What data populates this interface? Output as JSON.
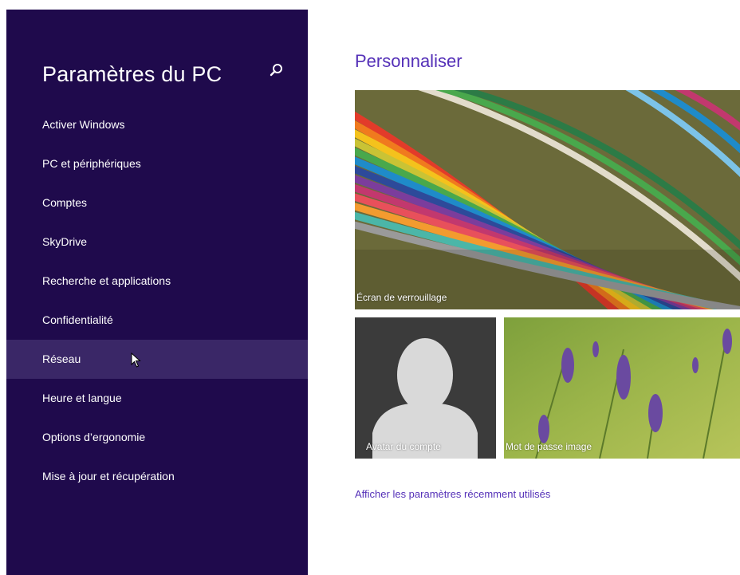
{
  "sidebar": {
    "title": "Paramètres du PC",
    "items": [
      {
        "label": "Activer Windows"
      },
      {
        "label": "PC et périphériques"
      },
      {
        "label": "Comptes"
      },
      {
        "label": "SkyDrive"
      },
      {
        "label": "Recherche et applications"
      },
      {
        "label": "Confidentialité"
      },
      {
        "label": "Réseau"
      },
      {
        "label": "Heure et langue"
      },
      {
        "label": "Options d’ergonomie"
      },
      {
        "label": "Mise à jour et récupération"
      }
    ],
    "hovered_item": "Réseau"
  },
  "main": {
    "title": "Personnaliser",
    "tiles": {
      "lock_screen": "Écran de verrouillage",
      "account_avatar": "Avatar du compte",
      "picture_password": "Mot de passe image"
    },
    "recent_link": "Afficher les paramètres récemment utilisés"
  },
  "colors": {
    "sidebar_bg": "#1f0a4c",
    "sidebar_hover": "#3a2767",
    "accent": "#5531b8"
  },
  "icons": {
    "search": "search-icon",
    "pointer": "mouse-pointer-icon"
  }
}
